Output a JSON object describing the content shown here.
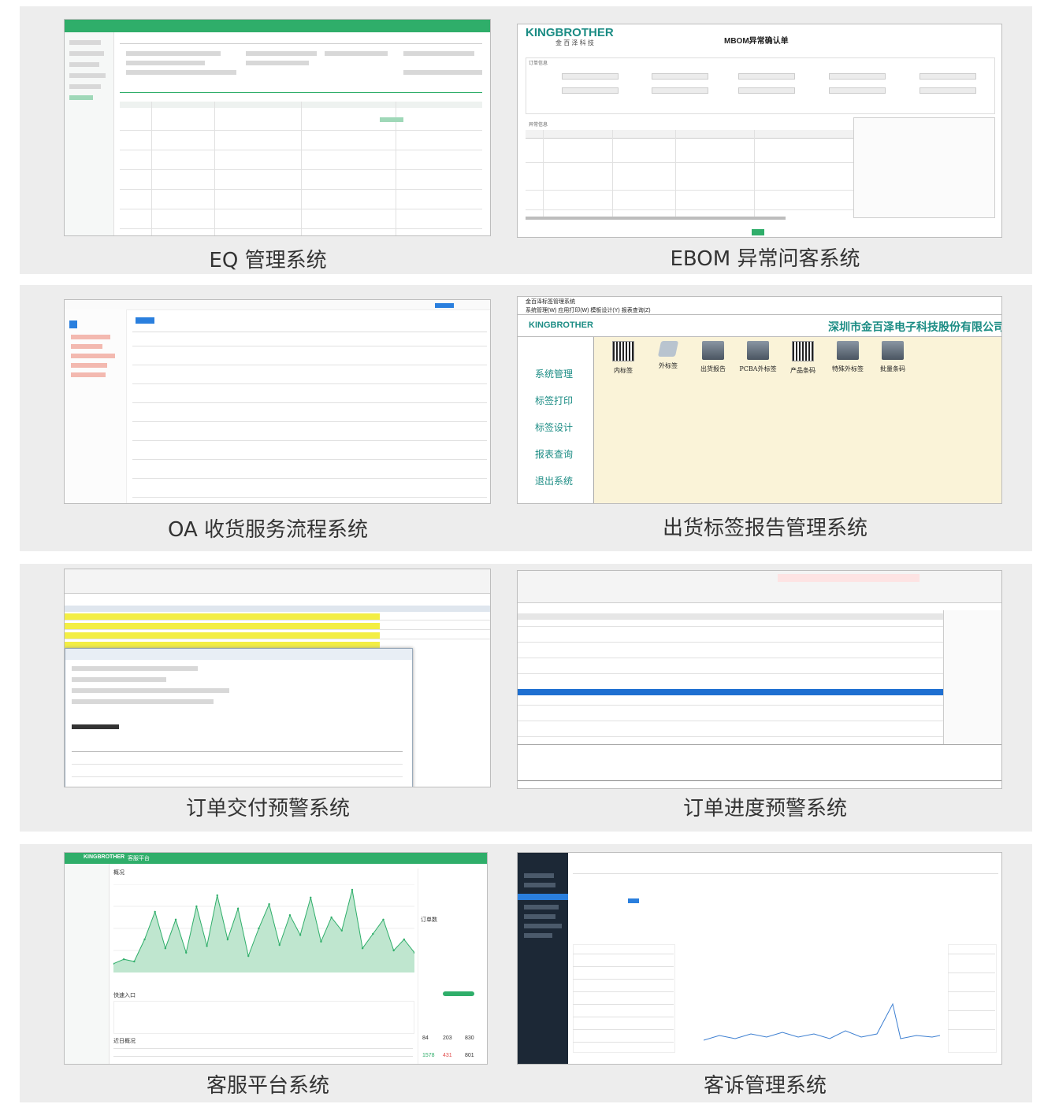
{
  "colors": {
    "card_bg": "#ededed",
    "eq_green": "#2fae6a",
    "kb_teal": "#1b8c84",
    "oa_blue": "#2a7fde",
    "cream": "#faf3d8",
    "yellow": "#f3ee44",
    "navy": "#1c2836"
  },
  "captions": {
    "eq": "EQ 管理系统",
    "ebom": "EBOM 异常问客系统",
    "oa": "OA 收货服务流程系统",
    "label": "出货标签报告管理系统",
    "delivery": "订单交付预警系统",
    "progress": "订单进度预警系统",
    "service": "客服平台系统",
    "complaint": "客诉管理系统"
  },
  "ebom": {
    "logo": "KINGBROTHER",
    "logo_sub": "金 百 泽 科 技",
    "title": "MBOM异常确认单",
    "section_order": "订单信息",
    "section_detail": "异常信息"
  },
  "label_app": {
    "window_title": "金百泽标签管理系统",
    "menubar": "系统管理(W)  应用打印(W)  模板设计(Y)  报表查询(Z)",
    "logo": "KINGBROTHER",
    "company": "深圳市金百泽电子科技股份有限公司",
    "side_menu": [
      "系统管理",
      "标签打印",
      "标签设计",
      "报表查询",
      "退出系统"
    ],
    "tools": [
      {
        "label": "内标签",
        "icon": "barcode-icon"
      },
      {
        "label": "外标签",
        "icon": "label-printer-icon"
      },
      {
        "label": "出货报告",
        "icon": "printer-icon"
      },
      {
        "label": "PCBA外标签",
        "icon": "printer-icon"
      },
      {
        "label": "产品条码",
        "icon": "barcode-icon"
      },
      {
        "label": "特殊外标签",
        "icon": "printer-icon"
      },
      {
        "label": "批量条码",
        "icon": "printer-icon"
      }
    ]
  },
  "service_app": {
    "logo": "KINGBROTHER",
    "platform": "客服平台",
    "section_overview": "概况",
    "section_entry": "快速入口",
    "section_recent": "近日概况",
    "section_orders": "订单数",
    "stats": [
      "84",
      "203",
      "830",
      "1578",
      "431",
      "801"
    ],
    "chart_data": {
      "type": "area",
      "values": [
        8,
        12,
        10,
        30,
        55,
        22,
        48,
        18,
        60,
        24,
        70,
        30,
        58,
        15,
        40,
        62,
        25,
        52,
        34,
        68,
        28,
        50,
        38,
        75,
        22,
        35,
        48,
        20,
        30,
        18
      ]
    }
  }
}
